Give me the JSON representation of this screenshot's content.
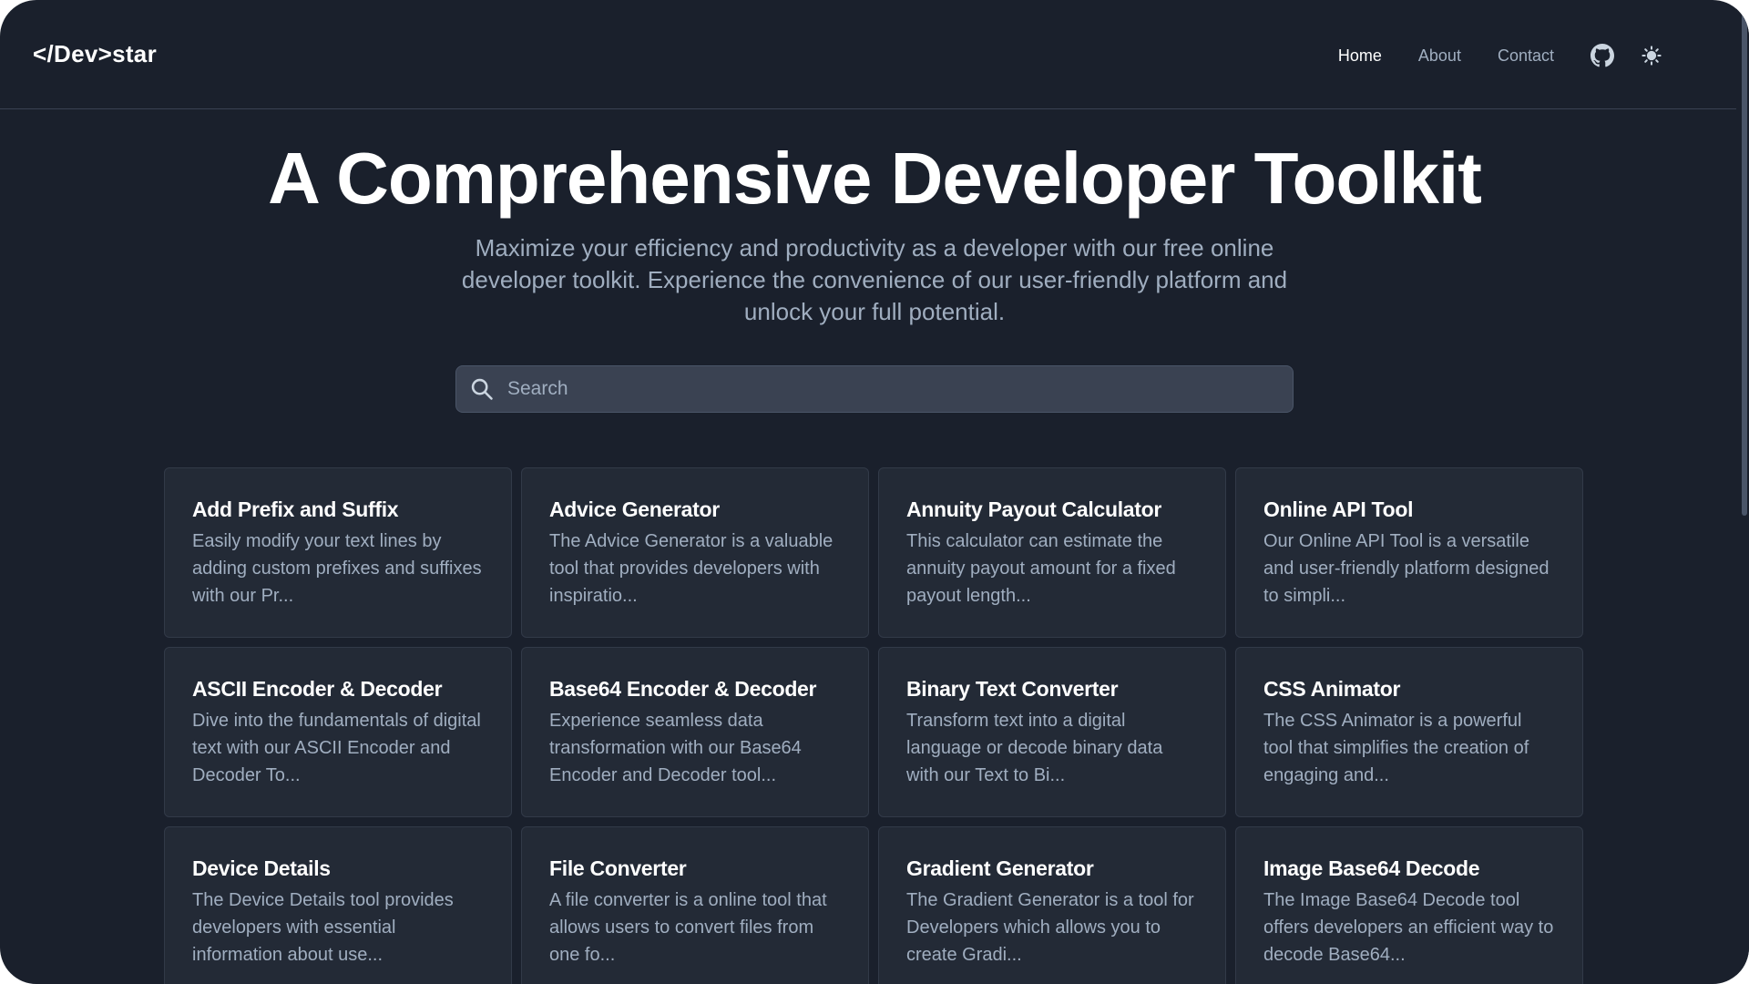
{
  "header": {
    "logo": "</Dev>star",
    "nav": [
      "Home",
      "About",
      "Contact"
    ],
    "icons": [
      "github-icon",
      "sun-icon"
    ]
  },
  "hero": {
    "title": "A Comprehensive Developer Toolkit",
    "subtitle": "Maximize your efficiency and productivity as a developer with our free online developer toolkit. Experience the convenience of our user-friendly platform and unlock your full potential."
  },
  "search": {
    "placeholder": "Search"
  },
  "tools": [
    {
      "title": "Add Prefix and Suffix",
      "desc": "Easily modify your text lines by adding custom prefixes and suffixes with our Pr..."
    },
    {
      "title": "Advice Generator",
      "desc": "The Advice Generator is a valuable tool that provides developers with inspiratio..."
    },
    {
      "title": "Annuity Payout Calculator",
      "desc": "This calculator can estimate the annuity payout amount for a fixed payout length..."
    },
    {
      "title": "Online API Tool",
      "desc": "Our Online API Tool is a versatile and user-friendly platform designed to simpli..."
    },
    {
      "title": "ASCII Encoder & Decoder",
      "desc": "Dive into the fundamentals of digital text with our ASCII Encoder and Decoder To..."
    },
    {
      "title": "Base64 Encoder & Decoder",
      "desc": "Experience seamless data transformation with our Base64 Encoder and Decoder tool..."
    },
    {
      "title": "Binary Text Converter",
      "desc": "Transform text into a digital language or decode binary data with our Text to Bi..."
    },
    {
      "title": "CSS Animator",
      "desc": "The CSS Animator is a powerful tool that simplifies the creation of engaging and..."
    },
    {
      "title": "Device Details",
      "desc": "The Device Details tool provides developers with essential information about use..."
    },
    {
      "title": "File Converter",
      "desc": "A file converter is a online tool that allows users to convert files from one fo..."
    },
    {
      "title": "Gradient Generator",
      "desc": "The Gradient Generator is a tool for Developers which allows you to create Gradi..."
    },
    {
      "title": "Image Base64 Decode",
      "desc": "The Image Base64 Decode tool offers developers an efficient way to decode Base64..."
    }
  ],
  "colors": {
    "background": "#1a202c",
    "card": "#232a36",
    "text_primary": "#ffffff",
    "text_muted": "#a0aec0"
  }
}
